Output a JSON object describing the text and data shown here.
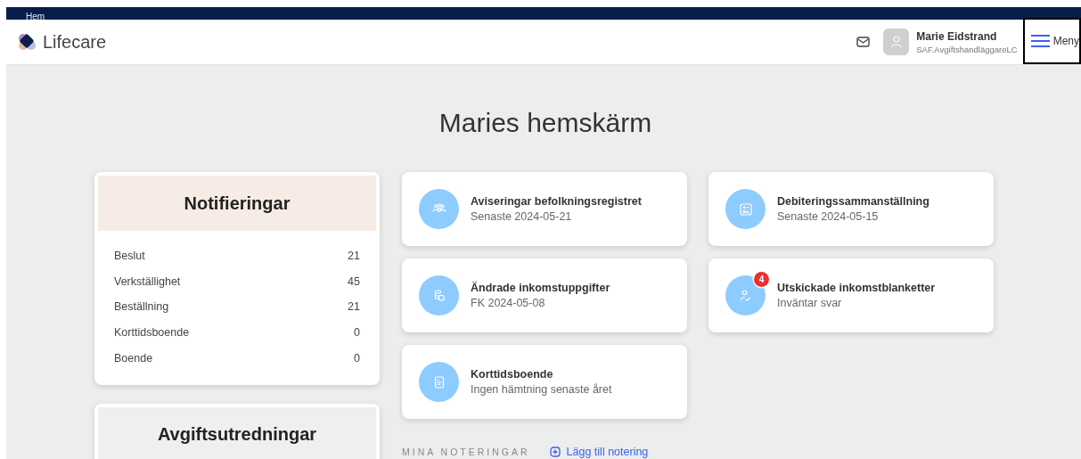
{
  "breadcrumb": "Hem",
  "app": {
    "name": "Lifecare"
  },
  "user": {
    "name": "Marie Eidstrand",
    "role": "SAF.AvgiftshandläggareLC"
  },
  "menu_button": {
    "label": "Meny"
  },
  "page_title": "Maries hemskärm",
  "panels": [
    {
      "title": "Notifieringar",
      "color": "#f7ebe5",
      "rows": [
        {
          "label": "Beslut",
          "count": "21"
        },
        {
          "label": "Verkställighet",
          "count": "45"
        },
        {
          "label": "Beställning",
          "count": "21"
        },
        {
          "label": "Korttidsboende",
          "count": "0"
        },
        {
          "label": "Boende",
          "count": "0"
        }
      ]
    },
    {
      "title": "Avgiftsutredningar",
      "color": "#efefef"
    }
  ],
  "tiles": [
    {
      "title": "Aviseringar befolkningsregistret",
      "subtitle": "Senaste 2024-05-21",
      "kind": "people"
    },
    {
      "title": "Debiteringssammanställning",
      "subtitle": "Senaste 2024-05-15",
      "kind": "calculator"
    },
    {
      "title": "Ändrade inkomstuppgifter",
      "subtitle": "FK 2024-05-08",
      "kind": "coins"
    },
    {
      "title": "Utskickade inkomstblanketter",
      "subtitle": "Inväntar svar",
      "kind": "person-check",
      "badge": "4"
    },
    {
      "title": "Korttidsboende",
      "subtitle": "Ingen hämtning senaste året",
      "kind": "document"
    }
  ],
  "notes": {
    "label": "MINA NOTERINGAR",
    "add_link": "Lägg till notering"
  }
}
